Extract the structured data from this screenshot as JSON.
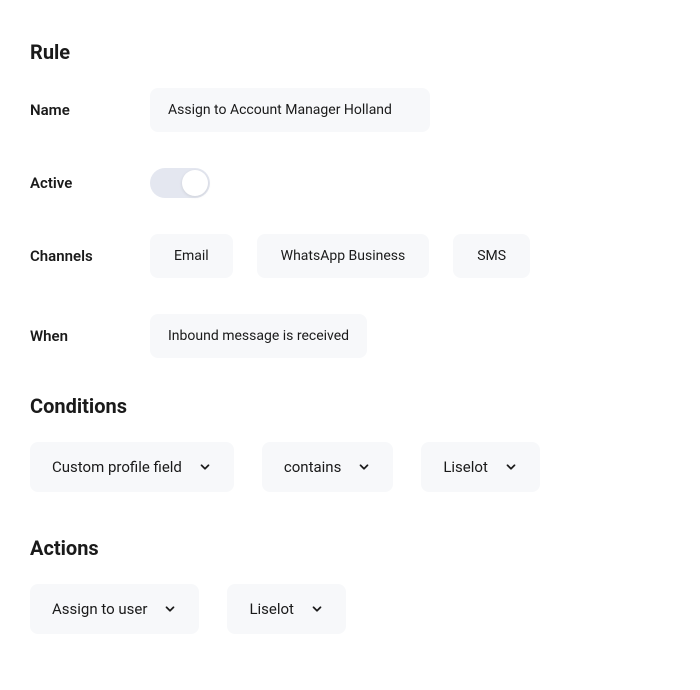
{
  "rule": {
    "title": "Rule",
    "name_label": "Name",
    "name_value": "Assign to Account Manager Holland",
    "active_label": "Active",
    "active_value": true,
    "channels_label": "Channels",
    "channels": [
      "Email",
      "WhatsApp Business",
      "SMS"
    ],
    "when_label": "When",
    "when_value": "Inbound message is received"
  },
  "conditions": {
    "title": "Conditions",
    "field": "Custom profile field",
    "operator": "contains",
    "value": "Liselot"
  },
  "actions": {
    "title": "Actions",
    "action": "Assign to user",
    "value": "Liselot"
  }
}
